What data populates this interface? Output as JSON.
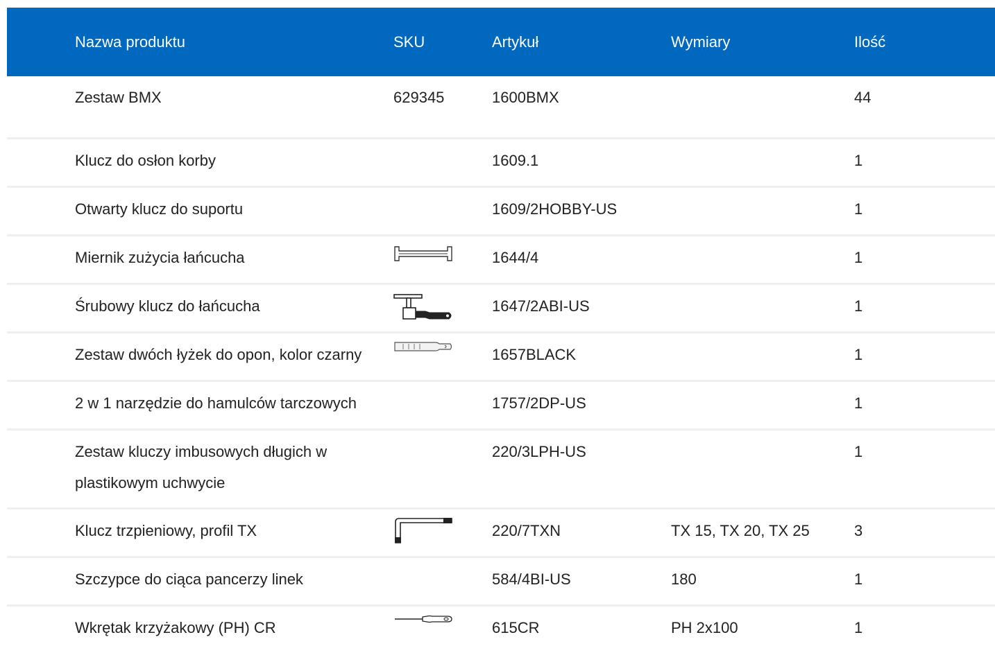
{
  "header": {
    "name": "Nazwa produktu",
    "sku": "SKU",
    "article": "Artykuł",
    "dimensions": "Wymiary",
    "quantity": "Ilość"
  },
  "rows": [
    {
      "name": "Zestaw BMX",
      "sku": "629345",
      "article": "1600BMX",
      "dimensions": "",
      "quantity": "44",
      "image": ""
    },
    {
      "name": "Klucz do osłon korby",
      "sku": "",
      "article": "1609.1",
      "dimensions": "",
      "quantity": "1",
      "image": ""
    },
    {
      "name": "Otwarty klucz do suportu",
      "sku": "",
      "article": "1609/2HOBBY-US",
      "dimensions": "",
      "quantity": "1",
      "image": ""
    },
    {
      "name": "Miernik zużycia łańcucha",
      "sku": "",
      "article": "1644/4",
      "dimensions": "",
      "quantity": "1",
      "image": "chain-gauge-icon"
    },
    {
      "name": "Śrubowy klucz do łańcucha",
      "sku": "",
      "article": "1647/2ABI-US",
      "dimensions": "",
      "quantity": "1",
      "image": "chain-tool-icon"
    },
    {
      "name": "Zestaw dwóch łyżek do opon, kolor czarny",
      "sku": "",
      "article": "1657BLACK",
      "dimensions": "",
      "quantity": "1",
      "image": "tire-lever-icon"
    },
    {
      "name": "2 w 1 narzędzie do hamulców tarczowych",
      "sku": "",
      "article": "1757/2DP-US",
      "dimensions": "",
      "quantity": "1",
      "image": ""
    },
    {
      "name": "Zestaw kluczy imbusowych długich w plastikowym uchwycie",
      "sku": "",
      "article": "220/3LPH-US",
      "dimensions": "",
      "quantity": "1",
      "image": ""
    },
    {
      "name": "Klucz trzpieniowy, profil TX",
      "sku": "",
      "article": "220/7TXN",
      "dimensions": "TX 15, TX 20, TX 25",
      "quantity": "3",
      "image": "torx-key-icon"
    },
    {
      "name": "Szczypce do ciąca pancerzy linek",
      "sku": "",
      "article": "584/4BI-US",
      "dimensions": "180",
      "quantity": "1",
      "image": ""
    },
    {
      "name": "Wkrętak krzyżakowy (PH) CR",
      "sku": "",
      "article": "615CR",
      "dimensions": "PH 2x100",
      "quantity": "1",
      "image": "screwdriver-icon"
    }
  ]
}
